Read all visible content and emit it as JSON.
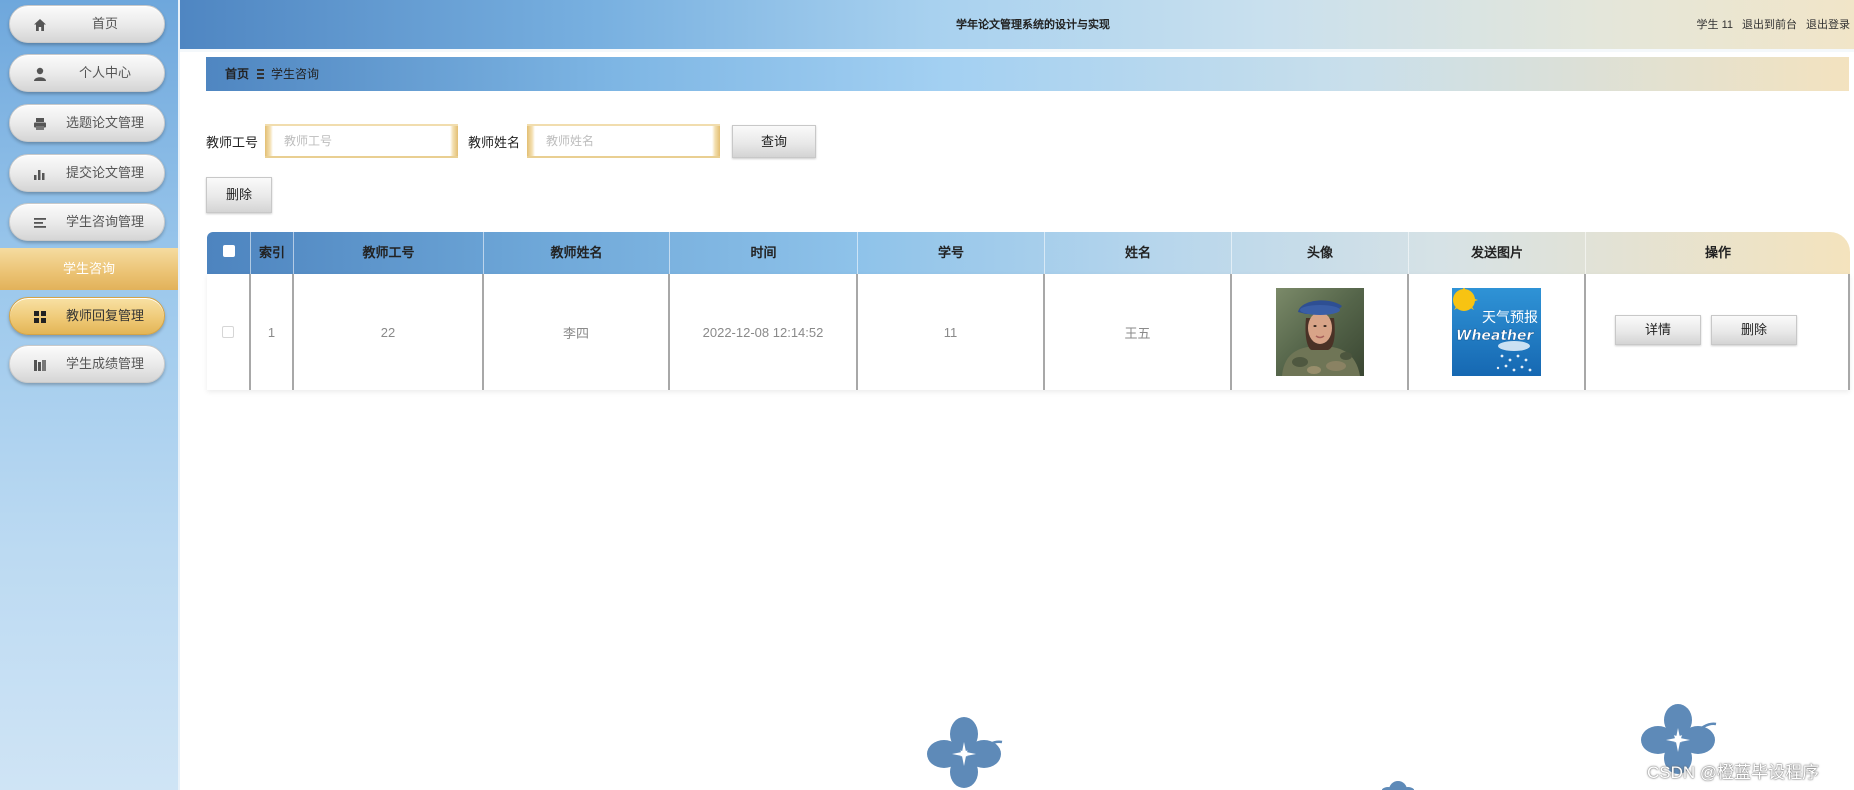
{
  "header": {
    "title": "学年论文管理系统的设计与实现",
    "user": "学生 11",
    "to_front": "退出到前台",
    "logout": "退出登录"
  },
  "sidebar": {
    "items": [
      {
        "label": "首页",
        "icon": "home-icon"
      },
      {
        "label": "个人中心",
        "icon": "user-icon"
      },
      {
        "label": "选题论文管理",
        "icon": "printer-icon"
      },
      {
        "label": "提交论文管理",
        "icon": "bar-chart-icon"
      },
      {
        "label": "学生咨询管理",
        "icon": "list-icon"
      },
      {
        "label": "教师回复管理",
        "icon": "grid-icon",
        "active": true
      },
      {
        "label": "学生成绩管理",
        "icon": "bars-icon"
      }
    ],
    "submenu": {
      "label": "学生咨询"
    }
  },
  "breadcrumb": {
    "home": "首页",
    "separator_icon": "menu-icon",
    "current": "学生咨询"
  },
  "search": {
    "teacher_id_label": "教师工号",
    "teacher_id_placeholder": "教师工号",
    "teacher_name_label": "教师姓名",
    "teacher_name_placeholder": "教师姓名",
    "query_button": "查询"
  },
  "actions": {
    "delete_button": "删除"
  },
  "table": {
    "columns": [
      "索引",
      "教师工号",
      "教师姓名",
      "时间",
      "学号",
      "姓名",
      "头像",
      "发送图片",
      "操作"
    ],
    "rows": [
      {
        "index": "1",
        "teacher_id": "22",
        "teacher_name": "李四",
        "time": "2022-12-08 12:14:52",
        "student_id": "11",
        "name": "王五",
        "avatar": "avatar-photo",
        "sent_image": {
          "title": "天气预报",
          "caption": "Wheather"
        },
        "detail_button": "详情",
        "delete_button": "删除"
      }
    ]
  },
  "watermark": "CSDN @橙蓝毕设程序",
  "colors": {
    "accent_gold": "#e9c27a",
    "header_blue": "#4f86c2",
    "header_beige": "#f1e5c8",
    "flower_blue": "#5e8ab8"
  }
}
